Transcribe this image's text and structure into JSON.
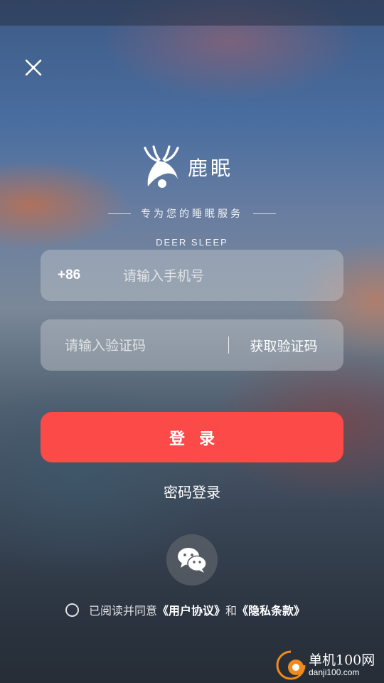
{
  "app": {
    "name": "鹿眠",
    "slogan": "专为您的睡眠服务",
    "slogan_en": "DEER SLEEP"
  },
  "form": {
    "country_code": "+86",
    "phone_placeholder": "请输入手机号",
    "code_placeholder": "请输入验证码",
    "get_code_label": "获取验证码"
  },
  "actions": {
    "login_label": "登录",
    "password_login_label": "密码登录"
  },
  "agreement": {
    "prefix": "已阅读并同意",
    "user_agreement": "《用户协议》",
    "joiner": "和",
    "privacy_policy": "《隐私条款》"
  },
  "watermark": {
    "cn": "单机100网",
    "url": "danji100.com"
  },
  "icons": {
    "close": "close-icon",
    "logo": "deer-logo-icon",
    "wechat": "wechat-icon",
    "watermark": "watermark-logo-icon"
  },
  "colors": {
    "accent": "#fb4a47"
  }
}
